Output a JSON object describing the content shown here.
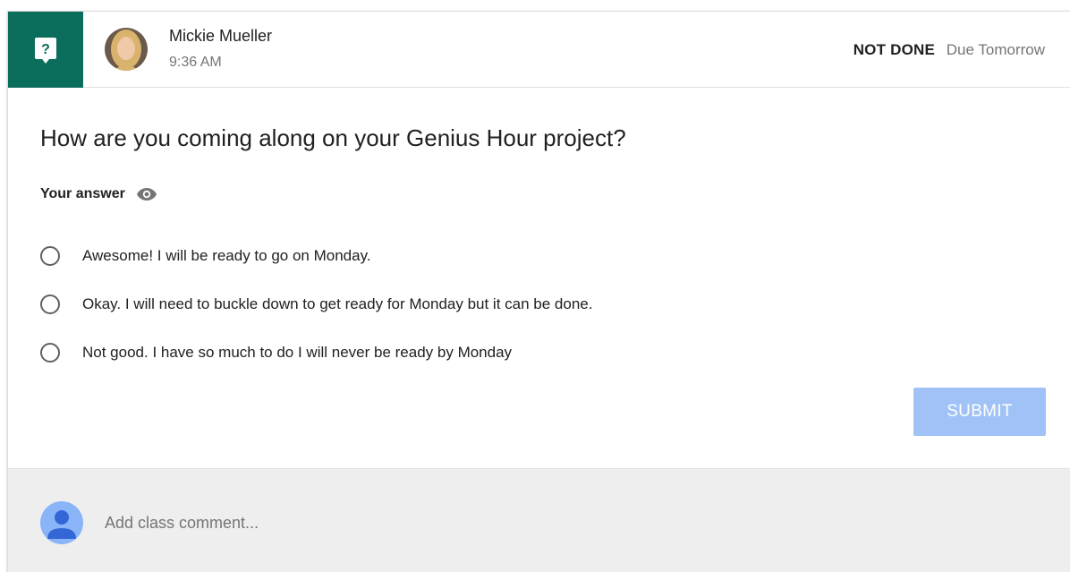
{
  "post": {
    "author_name": "Mickie Mueller",
    "time": "9:36 AM",
    "status": "NOT DONE",
    "due": "Due Tomorrow",
    "type_icon": "question-icon",
    "badge_color": "#0b6d5b"
  },
  "question": {
    "text": "How are you coming along on your Genius Hour project?",
    "answer_label": "Your answer",
    "visibility_icon": "eye-icon",
    "options": [
      {
        "label": "Awesome! I will be ready to go on Monday.",
        "selected": false
      },
      {
        "label": "Okay. I will need to buckle down to get ready for Monday but it can be done.",
        "selected": false
      },
      {
        "label": "Not good. I have so much to do I will never be ready by Monday",
        "selected": false
      }
    ],
    "submit_label": "SUBMIT",
    "submit_color": "#a0c2f6"
  },
  "comments": {
    "placeholder": "Add class comment...",
    "avatar_icon": "user-avatar-icon"
  }
}
